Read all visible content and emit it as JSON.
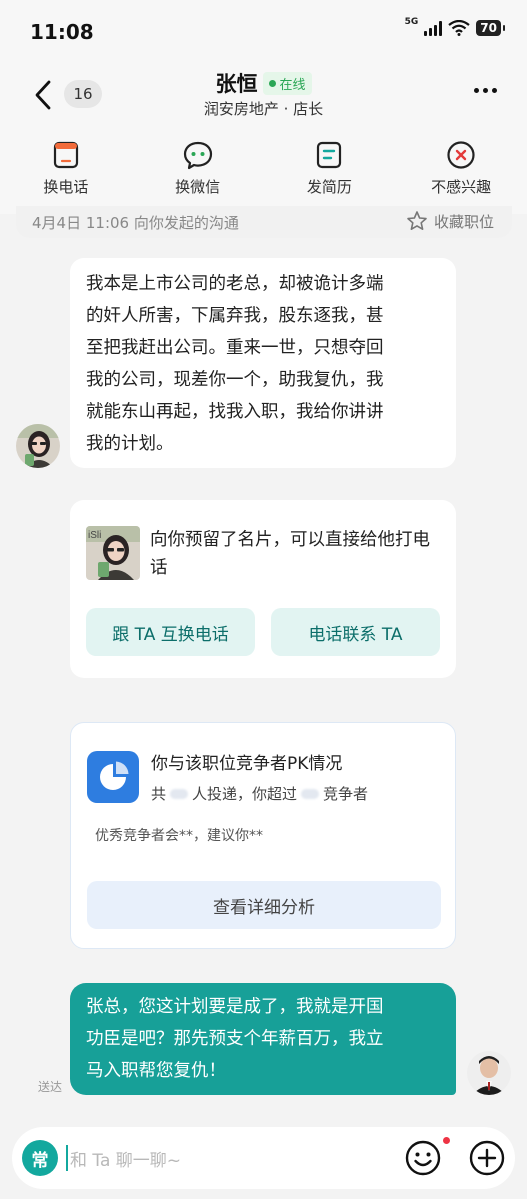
{
  "status_bar": {
    "time": "11:08",
    "network": "5G",
    "battery": "70"
  },
  "header": {
    "unread_count": "16",
    "name": "张恒",
    "online_label": "在线",
    "subtitle": "润安房地产 · 店长"
  },
  "actions": [
    {
      "label": "换电话",
      "icon": "phone-swap-icon"
    },
    {
      "label": "换微信",
      "icon": "wechat-icon"
    },
    {
      "label": "发简历",
      "icon": "resume-icon"
    },
    {
      "label": "不感兴趣",
      "icon": "not-interested-icon"
    }
  ],
  "strip": {
    "date_text": "4月4日 11:06 向你发起的沟通",
    "favorite_label": "收藏职位"
  },
  "messages": {
    "msg1_lines": [
      "我本是上市公司的老总，却被诡计多端",
      "的奸人所害，下属弃我，股东逐我，甚",
      "至把我赶出公司。重来一世，只想夺回",
      "我的公司，现差你一个，助我复仇，我",
      "就能东山再起，找我入职，我给你讲讲",
      "我的计划。"
    ],
    "card": {
      "text": "向你预留了名片，可以直接给他打电话",
      "btn_exchange": "跟 TA 互换电话",
      "btn_call": "电话联系 TA"
    },
    "pk": {
      "title": "你与该职位竞争者PK情况",
      "sub_prefix": "共",
      "sub_middle": "人投递，你超过",
      "sub_suffix": "竞争者",
      "note": "优秀竞争者会**，建议你**",
      "button": "查看详细分析"
    },
    "reply_lines": [
      "张总，您这计划要是成了，我就是开国",
      "功臣是吧？那先预支个年薪百万，我立",
      "马入职帮您复仇！"
    ],
    "sent_label": "送达"
  },
  "input": {
    "common_label": "常",
    "placeholder": "和 Ta 聊一聊~"
  },
  "colors": {
    "accent": "#17a098",
    "online": "#2aa655",
    "pk_blue": "#2e7de0"
  }
}
